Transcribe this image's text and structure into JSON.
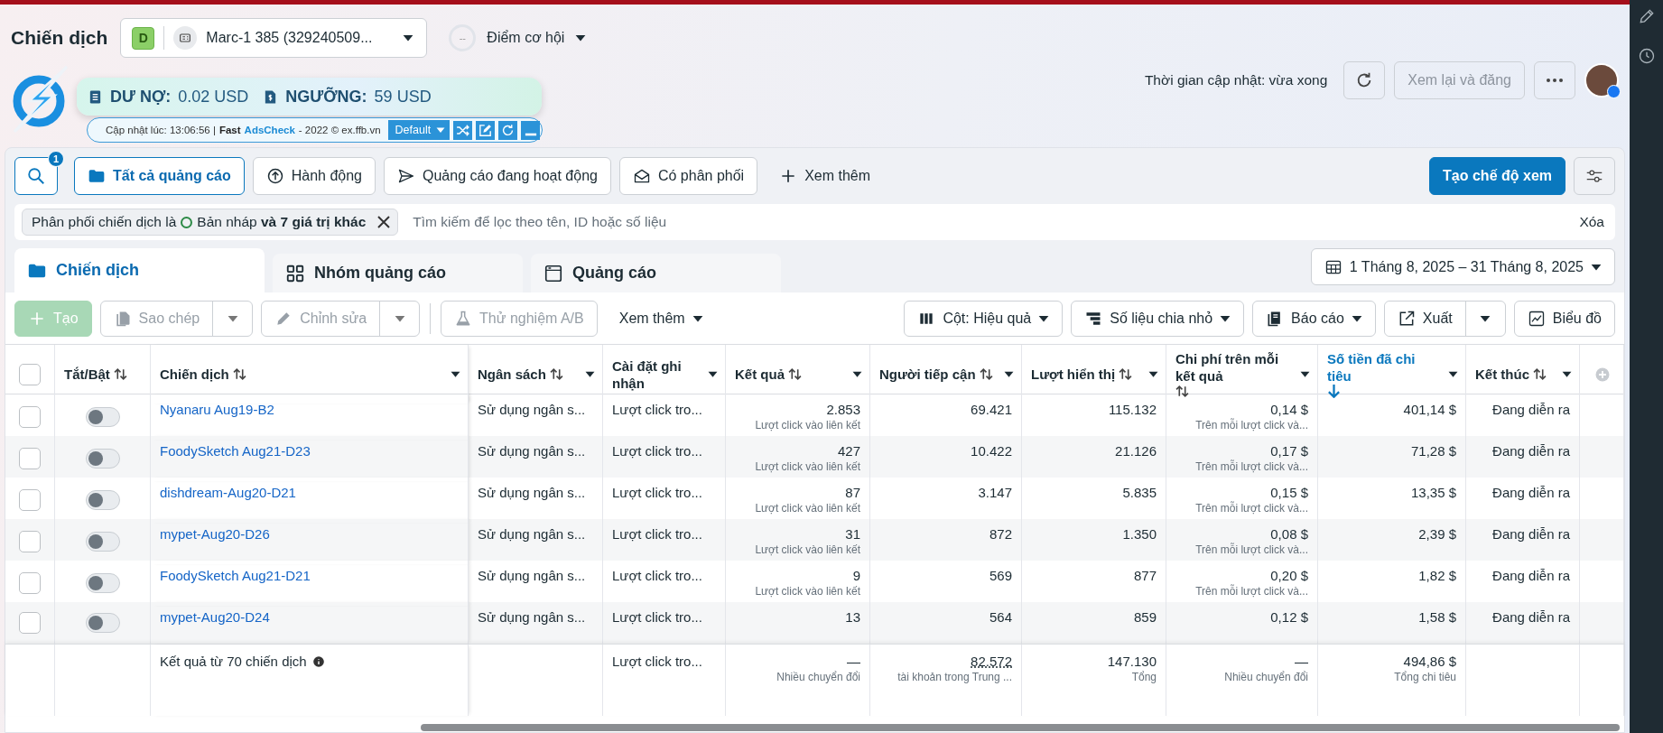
{
  "page_title": "Chiến dịch",
  "account": {
    "badge": "D",
    "name": "Marc-1 385 (329240509..."
  },
  "opportunity": {
    "score": "--",
    "label": "Điểm cơ hội"
  },
  "update_status": "Thời gian cập nhật: vừa xong",
  "review_button": {
    "label": "Xem lại và đăng",
    "disabled": true
  },
  "extension": {
    "debt_label": "DƯ NỢ:",
    "debt": "0.02 USD",
    "threshold_label": "NGƯỠNG:",
    "threshold": "59 USD",
    "updated": "Cập nhật lúc: 13:06:56 |",
    "brand_prefix": "Fast",
    "brand": "AdsCheck",
    "copyright": "- 2022 © ex.ffb.vn",
    "profile": "Default"
  },
  "search_badge": "1",
  "quick_filters": [
    {
      "label": "Tất cả quảng cáo",
      "selected": true,
      "kind": "folder"
    },
    {
      "label": "Hành động",
      "selected": false,
      "kind": "upload"
    },
    {
      "label": "Quảng cáo đang hoạt động",
      "selected": false,
      "kind": "send"
    },
    {
      "label": "Có phân phối",
      "selected": false,
      "kind": "mail"
    },
    {
      "label": "Xem thêm",
      "selected": false,
      "kind": "plus"
    }
  ],
  "create_view_button": "Tạo chế độ xem",
  "filter": {
    "field": "Phân phối chiến dịch là",
    "value": "Bản nháp **và 7 giá trị khác**",
    "placeholder": "Tìm kiếm để lọc theo tên, ID hoặc số liệu",
    "clear": "Xóa"
  },
  "level_tabs": [
    {
      "label": "Chiến dịch",
      "selected": true,
      "kind": "folder"
    },
    {
      "label": "Nhóm quảng cáo",
      "selected": false,
      "kind": "grid"
    },
    {
      "label": "Quảng cáo",
      "selected": false,
      "kind": "window"
    }
  ],
  "date_range": "1 Tháng 8, 2025 – 31 Tháng 8, 2025",
  "actions_left": [
    {
      "label": "Tạo",
      "kind": "create",
      "disabled": true,
      "menu": false,
      "split": false
    },
    {
      "label": "Sao chép",
      "kind": "copy",
      "disabled": true,
      "menu": false,
      "split": true
    },
    {
      "label": "Chỉnh sửa",
      "kind": "edit",
      "disabled": true,
      "menu": false,
      "split": true
    },
    {
      "label": "Thử nghiệm A/B",
      "kind": "flask",
      "disabled": true,
      "menu": false,
      "split": false
    },
    {
      "label": "Xem thêm",
      "kind": "more",
      "disabled": false,
      "menu": true,
      "split": false
    }
  ],
  "actions_right": [
    {
      "label": "Cột: Hiệu quả",
      "kind": "columns",
      "menu": true,
      "split": false
    },
    {
      "label": "Số liệu chia nhỏ",
      "kind": "breakdown",
      "menu": true,
      "split": false
    },
    {
      "label": "Báo cáo",
      "kind": "report",
      "menu": true,
      "split": false
    },
    {
      "label": "Xuất",
      "kind": "export",
      "menu": false,
      "split": true
    },
    {
      "label": "Biểu đồ",
      "kind": "chart",
      "menu": false,
      "split": false
    }
  ],
  "table": {
    "select_all": {
      "checked": false
    },
    "columns": [
      {
        "kind": "toggle",
        "label": "Tắt/Bật",
        "sortable": true,
        "sorted": false,
        "menu": false
      },
      {
        "kind": "name",
        "label": "Chiến dịch",
        "sortable": true,
        "sorted": false,
        "menu": true
      },
      {
        "kind": "text",
        "label": "Ngân sách",
        "sortable": true,
        "sorted": false,
        "menu": true
      },
      {
        "kind": "text",
        "label": "Cài đặt ghi nhận",
        "sortable": false,
        "sorted": false,
        "menu": true
      },
      {
        "kind": "number",
        "label": "Kết quả",
        "sortable": true,
        "sorted": false,
        "menu": true
      },
      {
        "kind": "number",
        "label": "Người tiếp cận",
        "sortable": true,
        "sorted": false,
        "menu": true
      },
      {
        "kind": "number",
        "label": "Lượt hiển thị",
        "sortable": true,
        "sorted": false,
        "menu": true
      },
      {
        "kind": "number",
        "label": "Chi phí trên mỗi kết quả",
        "sortable": true,
        "sorted": false,
        "menu": true
      },
      {
        "kind": "number",
        "label": "Số tiền đã chi tiêu",
        "sortable": true,
        "sorted": true,
        "menu": true
      },
      {
        "kind": "number",
        "label": "Kết thúc",
        "sortable": true,
        "sorted": false,
        "menu": true
      }
    ],
    "rows": [
      {
        "checked": false,
        "cells": [
          {
            "on": false
          },
          {
            "text": "Nyanaru Aug19-B2"
          },
          {
            "text": "Sử dụng ngân s..."
          },
          {
            "text": "Lượt click tro..."
          },
          {
            "text": "2.853",
            "sub": "Lượt click vào liên kết"
          },
          {
            "text": "69.421"
          },
          {
            "text": "115.132"
          },
          {
            "text": "0,14 $",
            "sub": "Trên mỗi lượt click và..."
          },
          {
            "text": "401,14 $"
          },
          {
            "text": "Đang diễn ra"
          }
        ]
      },
      {
        "checked": false,
        "cells": [
          {
            "on": false
          },
          {
            "text": "FoodySketch Aug21-D23"
          },
          {
            "text": "Sử dụng ngân s..."
          },
          {
            "text": "Lượt click tro..."
          },
          {
            "text": "427",
            "sub": "Lượt click vào liên kết"
          },
          {
            "text": "10.422"
          },
          {
            "text": "21.126"
          },
          {
            "text": "0,17 $",
            "sub": "Trên mỗi lượt click và..."
          },
          {
            "text": "71,28 $"
          },
          {
            "text": "Đang diễn ra"
          }
        ]
      },
      {
        "checked": false,
        "cells": [
          {
            "on": false
          },
          {
            "text": "dishdream-Aug20-D21"
          },
          {
            "text": "Sử dụng ngân s..."
          },
          {
            "text": "Lượt click tro..."
          },
          {
            "text": "87",
            "sub": "Lượt click vào liên kết"
          },
          {
            "text": "3.147"
          },
          {
            "text": "5.835"
          },
          {
            "text": "0,15 $",
            "sub": "Trên mỗi lượt click và..."
          },
          {
            "text": "13,35 $"
          },
          {
            "text": "Đang diễn ra"
          }
        ]
      },
      {
        "checked": false,
        "cells": [
          {
            "on": false
          },
          {
            "text": "mypet-Aug20-D26"
          },
          {
            "text": "Sử dụng ngân s..."
          },
          {
            "text": "Lượt click tro..."
          },
          {
            "text": "31",
            "sub": "Lượt click vào liên kết"
          },
          {
            "text": "872"
          },
          {
            "text": "1.350"
          },
          {
            "text": "0,08 $",
            "sub": "Trên mỗi lượt click và..."
          },
          {
            "text": "2,39 $"
          },
          {
            "text": "Đang diễn ra"
          }
        ]
      },
      {
        "checked": false,
        "cells": [
          {
            "on": false
          },
          {
            "text": "FoodySketch Aug21-D21"
          },
          {
            "text": "Sử dụng ngân s..."
          },
          {
            "text": "Lượt click tro..."
          },
          {
            "text": "9",
            "sub": "Lượt click vào liên kết"
          },
          {
            "text": "569"
          },
          {
            "text": "877"
          },
          {
            "text": "0,20 $",
            "sub": "Trên mỗi lượt click và..."
          },
          {
            "text": "1,82 $"
          },
          {
            "text": "Đang diễn ra"
          }
        ]
      },
      {
        "checked": false,
        "cells": [
          {
            "on": false
          },
          {
            "text": "mypet-Aug20-D24"
          },
          {
            "text": "Sử dụng ngân s..."
          },
          {
            "text": "Lượt click tro..."
          },
          {
            "text": "13"
          },
          {
            "text": "564"
          },
          {
            "text": "859"
          },
          {
            "text": "0,12 $"
          },
          {
            "text": "1,58 $"
          },
          {
            "text": "Đang diễn ra"
          }
        ]
      }
    ],
    "footer": {
      "cells": [
        null,
        {
          "text": "Kết quả từ 70 chiến dịch"
        },
        null,
        {
          "text": "Lượt click tro..."
        },
        {
          "text": "—",
          "sub": "Nhiều chuyển đổi"
        },
        {
          "text": "82.572",
          "sub": "tài khoản trong Trung ...",
          "dotted": true
        },
        {
          "text": "147.130",
          "sub": "Tổng"
        },
        {
          "text": "—",
          "sub": "Nhiều chuyển đổi"
        },
        {
          "text": "494,86 $",
          "sub": "Tổng chi tiêu"
        },
        null
      ]
    }
  }
}
